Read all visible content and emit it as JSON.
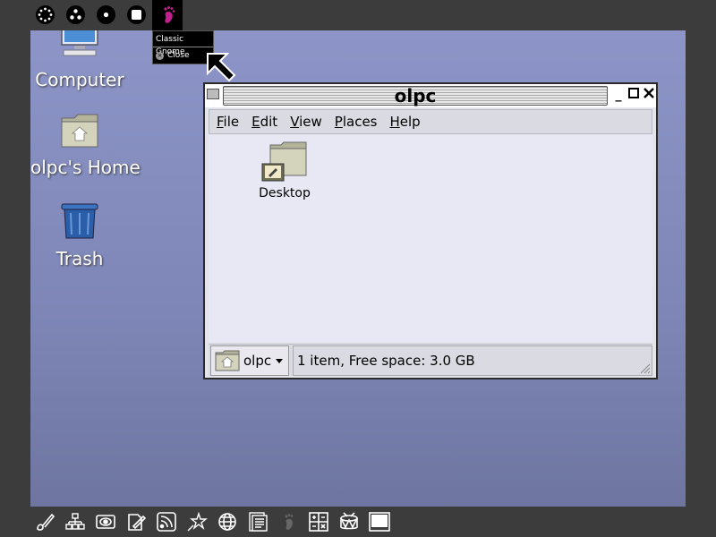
{
  "topbar": {
    "icons": [
      {
        "name": "neighborhood-icon"
      },
      {
        "name": "group-icon"
      },
      {
        "name": "home-icon"
      },
      {
        "name": "activity-icon"
      },
      {
        "name": "gnome-foot-icon"
      }
    ]
  },
  "popup": {
    "title": "Classic Gnome",
    "close_label": "Close"
  },
  "desktop": {
    "icons": [
      {
        "label": "Computer"
      },
      {
        "label": "olpc's Home"
      },
      {
        "label": "Trash"
      }
    ]
  },
  "window": {
    "title": "olpc",
    "menu": [
      "File",
      "Edit",
      "View",
      "Places",
      "Help"
    ],
    "items": [
      {
        "label": "Desktop"
      }
    ],
    "location": "olpc",
    "status": "1 item, Free space: 3.0 GB"
  },
  "bottombar": {
    "icons": [
      "paint-icon",
      "network-icon",
      "eye-icon",
      "write-icon",
      "rss-icon",
      "star-icon",
      "browse-icon",
      "read-icon",
      "foot-icon",
      "calculate-icon",
      "drum-icon",
      "screen-icon"
    ]
  },
  "colors": {
    "desktop_top": "#8d95c8",
    "desktop_bottom": "#6e75a0",
    "frame": "#3c3c3c",
    "gnome_accent": "#c2208e"
  }
}
